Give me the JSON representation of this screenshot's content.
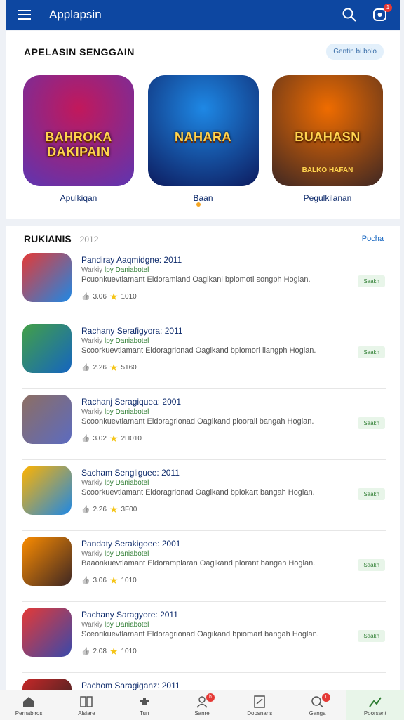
{
  "appbar": {
    "title": "Applapsin",
    "notification_count": "1"
  },
  "featured": {
    "title": "APELASIN SENGGAIN",
    "button": "Gentin bi.bolo",
    "cards": [
      {
        "banner": "BAHROKA DAKIPAIN",
        "sub": "",
        "label": "Apulkiqan",
        "colors": [
          "#c2185b",
          "#5e35b1"
        ]
      },
      {
        "banner": "NAHARA",
        "sub": "",
        "label": "Baan",
        "colors": [
          "#1e88e5",
          "#0d1b5e"
        ]
      },
      {
        "banner": "BUAHASN",
        "sub": "BALKO HAFAN",
        "label": "Pegulkilanan",
        "colors": [
          "#ef6c00",
          "#3e2723"
        ]
      }
    ]
  },
  "list": {
    "title": "RUKIANIS",
    "year": "2012",
    "more": "Pocha",
    "items": [
      {
        "name": "Pandiray Aaqmidgne: 2011",
        "dev_prefix": "Warkiy",
        "dev": "lpy Daniabotel",
        "desc": "Pcuonkuevtlamant Eldoramiand Oagikanl bpiomoti songph Hoglan.",
        "rating": "3.06",
        "downloads": "1010",
        "get": "Saakn",
        "colors": [
          "#e53935",
          "#1e88e5"
        ]
      },
      {
        "name": "Rachany Serafigyora: 2011",
        "dev_prefix": "Warkiy",
        "dev": "lpy Daniabotel",
        "desc": "Scoorkuevtiamant Eldoragrionad Oagikand bpiomorl llangph Hoglan.",
        "rating": "2.26",
        "downloads": "5160",
        "get": "Saakn",
        "colors": [
          "#43a047",
          "#1565c0"
        ]
      },
      {
        "name": "Rachanj Seragiquea: 2001",
        "dev_prefix": "Warkiy",
        "dev": "lpy Daniabotel",
        "desc": "Scoonkuevtiamant Eldoragrionad Oagikand pioorali bangah Hoglan.",
        "rating": "3.02",
        "downloads": "2H010",
        "get": "Saakn",
        "colors": [
          "#8d6e63",
          "#5c6bc0"
        ]
      },
      {
        "name": "Sacham Sengliguee: 2011",
        "dev_prefix": "Warkiy",
        "dev": "lpy Daniabotel",
        "desc": "Scoorkuevtlamant Eldoragrionad Oagikand bpiokart bangah Hoglan.",
        "rating": "2.26",
        "downloads": "3F00",
        "get": "Saakn",
        "colors": [
          "#ffb300",
          "#1e88e5"
        ]
      },
      {
        "name": "Pandaty Serakigoee: 2001",
        "dev_prefix": "Warkiy",
        "dev": "lpy Daniabotel",
        "desc": "Baaonkuevtlamant Eldoramplaran Oagikand piorant bangah Hoglan.",
        "rating": "3.06",
        "downloads": "1010",
        "get": "Saakn",
        "colors": [
          "#fb8c00",
          "#3e2723"
        ]
      },
      {
        "name": "Pachany Saragyore: 2011",
        "dev_prefix": "Warkiy",
        "dev": "lpy Daniabotel",
        "desc": "Sceorikuevtlamant Eldoragrionad Oagikand bpiomart bangah Hoglan.",
        "rating": "2.08",
        "downloads": "1010",
        "get": "Saakn",
        "colors": [
          "#e53935",
          "#3949ab"
        ]
      },
      {
        "name": "Pachom Saragiganz: 2011",
        "dev_prefix": "",
        "dev": "",
        "desc": "",
        "rating": "",
        "downloads": "",
        "get": "",
        "colors": [
          "#c62828",
          "#212121"
        ]
      }
    ]
  },
  "bottomnav": [
    {
      "label": "Pernabiros",
      "icon": "home-icon"
    },
    {
      "label": "Alsiare",
      "icon": "grid-icon"
    },
    {
      "label": "Tun",
      "icon": "puzzle-icon"
    },
    {
      "label": "Sanre",
      "icon": "people-icon",
      "badge": "h"
    },
    {
      "label": "Dopsnarls",
      "icon": "document-icon"
    },
    {
      "label": "Ganga",
      "icon": "search-user-icon",
      "badge": "1"
    },
    {
      "label": "Poorsent",
      "icon": "chart-icon",
      "active": true
    }
  ]
}
